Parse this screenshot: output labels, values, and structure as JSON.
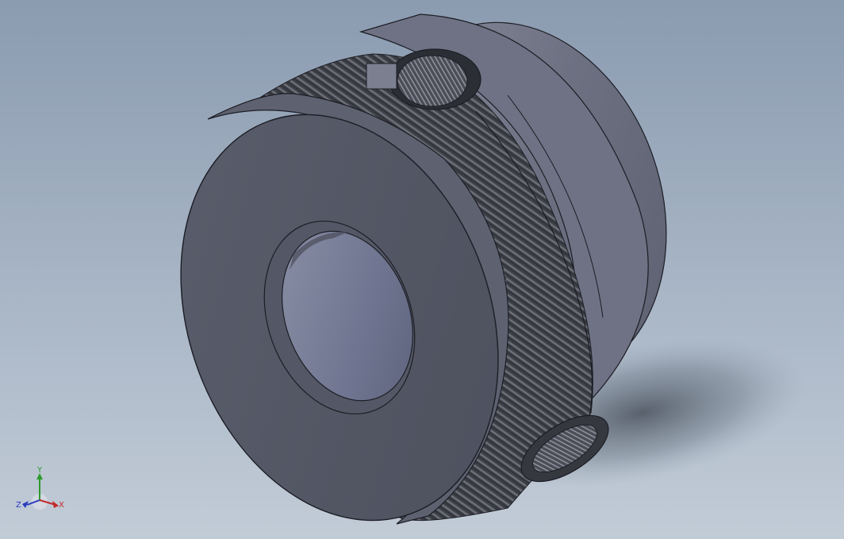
{
  "graphics_area": {
    "model": "shaft-collar",
    "colors": {
      "background_top": "#8b9bb0",
      "background_bottom": "#c2ccd7",
      "part_face": "#5a5e6c",
      "part_rim": "#7d8192",
      "edge": "#1c1d24"
    }
  },
  "triad": {
    "x_label": "X",
    "y_label": "Y",
    "z_label": "Z",
    "x_color": "#c42a2a",
    "y_color": "#2c9a2c",
    "z_color": "#2a3cbf"
  }
}
